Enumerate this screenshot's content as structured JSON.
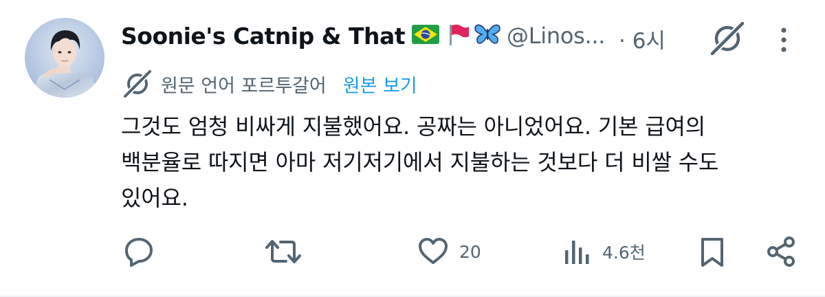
{
  "user": {
    "display_name": "Soonie's Catnip & That",
    "name_emojis": [
      "brazil-flag",
      "red-flag",
      "butterfly"
    ],
    "handle": "@Linos...",
    "time": "· 6시"
  },
  "translation": {
    "label": "원문 언어 포르투갈어",
    "view_original": "원본 보기"
  },
  "body": {
    "lines": [
      "그것도 엄청 비싸게 지불했어요.  공짜는 아니었어요.  기본 급여의",
      "백분율로 따지면 아마 저기저기에서 지불하는 것보다 더 비쌀 수도",
      "있어요."
    ]
  },
  "actions": {
    "reply_count": "",
    "retweet_count": "",
    "like_count": "20",
    "views_count": "4.6천"
  },
  "colors": {
    "text_primary": "#0f1419",
    "text_secondary": "#536471",
    "accent": "#1d9bf0",
    "divider": "#eff3f4"
  }
}
